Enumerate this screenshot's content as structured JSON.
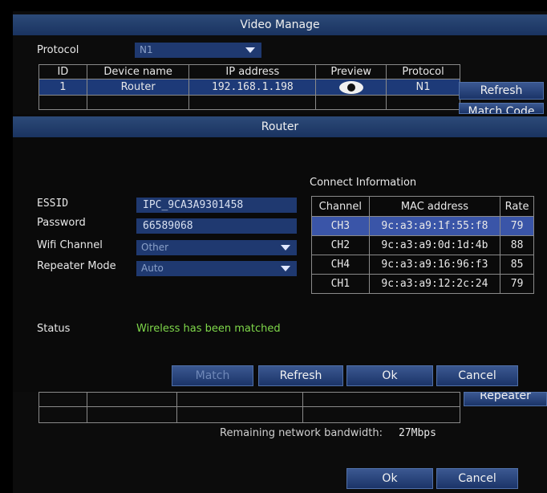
{
  "video_manage": {
    "title": "Video Manage",
    "protocol_label": "Protocol",
    "protocol_value": "N1",
    "table": {
      "headers": [
        "ID",
        "Device name",
        "IP address",
        "Preview",
        "Protocol"
      ],
      "rows": [
        {
          "id": "1",
          "device": "Router",
          "ip": "192.168.1.198",
          "preview": "eye-icon",
          "protocol": "N1"
        }
      ]
    },
    "refresh_label": "Refresh",
    "match_code_label": "Match Code",
    "repeater_label": "Repeater",
    "bandwidth_label": "Remaining network bandwidth:",
    "bandwidth_value": "27Mbps",
    "ok_label": "Ok",
    "cancel_label": "Cancel"
  },
  "router": {
    "title": "Router",
    "essid_label": "ESSID",
    "essid_value": "IPC_9CA3A9301458",
    "password_label": "Password",
    "password_value": "66589068",
    "wifi_channel_label": "Wifi Channel",
    "wifi_channel_value": "Other",
    "repeater_mode_label": "Repeater Mode",
    "repeater_mode_value": "Auto",
    "connect_info_label": "Connect Information",
    "connect_headers": [
      "Channel",
      "MAC address",
      "Rate"
    ],
    "connect_rows": [
      {
        "channel": "CH3",
        "mac": "9c:a3:a9:1f:55:f8",
        "rate": "79"
      },
      {
        "channel": "CH2",
        "mac": "9c:a3:a9:0d:1d:4b",
        "rate": "88"
      },
      {
        "channel": "CH4",
        "mac": "9c:a3:a9:16:96:f3",
        "rate": "85"
      },
      {
        "channel": "CH1",
        "mac": "9c:a3:a9:12:2c:24",
        "rate": "79"
      }
    ],
    "status_label": "Status",
    "status_value": "Wireless has been matched",
    "match_label": "Match",
    "refresh_label": "Refresh",
    "ok_label": "Ok",
    "cancel_label": "Cancel"
  },
  "colors": {
    "title_bar": "#2c4a78",
    "field_bg": "#1f3970",
    "selected_row": "#3a55a8",
    "status_ok": "#7fd84a"
  }
}
